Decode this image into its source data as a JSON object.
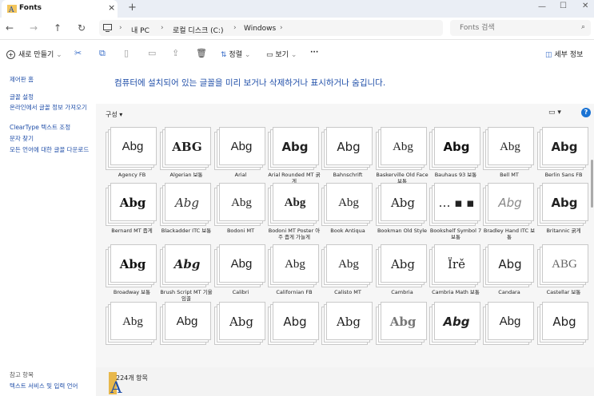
{
  "window": {
    "tab_title": "Fonts",
    "tab_close": "×",
    "new_tab": "+",
    "minimize": "—",
    "maximize": "☐",
    "close": "✕"
  },
  "nav": {
    "back": "←",
    "forward": "→",
    "up": "↑",
    "refresh": "↻"
  },
  "breadcrumb": [
    "내 PC",
    "로컬 디스크 (C:)",
    "Windows"
  ],
  "search": {
    "placeholder": "Fonts 검색"
  },
  "commands": {
    "new": "새로 만들기",
    "sort": "정렬",
    "view": "보기",
    "more": "···",
    "details": "세부 정보"
  },
  "sidebar": {
    "items": [
      "제어판 홈",
      "글꼴 설정",
      "온라인에서 글꼴 정보 가져오기",
      "ClearType 텍스트 조정",
      "문자 찾기",
      "모든 언어에 대한 글꼴 다운로드"
    ],
    "see_also_title": "참고 항목",
    "see_also": [
      "텍스트 서비스 및 입력 언어"
    ]
  },
  "main": {
    "headline": "컴퓨터에 설치되어 있는 글꼴을 미리 보거나 삭제하거나 표시하거나 숨깁니다.",
    "organize": "구성 ▾",
    "help": "?"
  },
  "fonts": [
    {
      "name": "Agency FB",
      "sample": "Abg",
      "family": "Liberation Sans Narrow",
      "weight": "normal",
      "style": "normal",
      "color": "#222222"
    },
    {
      "name": "Algerian 보통",
      "sample": "ABG",
      "family": "DejaVu Serif",
      "weight": "bold",
      "style": "normal",
      "color": "#222222"
    },
    {
      "name": "Arial",
      "sample": "Abg",
      "family": "Liberation Sans",
      "weight": "normal",
      "style": "normal",
      "color": "#222222"
    },
    {
      "name": "Arial Rounded MT 굵게",
      "sample": "Abg",
      "family": "DejaVu Sans",
      "weight": "bold",
      "style": "normal",
      "color": "#222222"
    },
    {
      "name": "Bahnschrift",
      "sample": "Abg",
      "family": "DejaVu Sans",
      "weight": "normal",
      "style": "normal",
      "color": "#222222"
    },
    {
      "name": "Baskerville Old Face 보통",
      "sample": "Abg",
      "family": "Liberation Serif",
      "weight": "normal",
      "style": "normal",
      "color": "#222222"
    },
    {
      "name": "Bauhaus 93 보통",
      "sample": "Abg",
      "family": "DejaVu Sans",
      "weight": "bold",
      "style": "normal",
      "color": "#111111"
    },
    {
      "name": "Bell MT",
      "sample": "Abg",
      "family": "Liberation Serif",
      "weight": "normal",
      "style": "normal",
      "color": "#222222"
    },
    {
      "name": "Berlin Sans FB",
      "sample": "Abg",
      "family": "DejaVu Sans",
      "weight": "bold",
      "style": "normal",
      "color": "#222222"
    },
    {
      "name": "Bernard MT 좁게",
      "sample": "Abg",
      "family": "DejaVu Serif",
      "weight": "bold",
      "style": "normal",
      "color": "#111111"
    },
    {
      "name": "Blackadder ITC 보통",
      "sample": "Abg",
      "family": "DejaVu Serif",
      "weight": "normal",
      "style": "italic",
      "color": "#333333"
    },
    {
      "name": "Bodoni MT",
      "sample": "Abg",
      "family": "Liberation Serif",
      "weight": "normal",
      "style": "normal",
      "color": "#222222"
    },
    {
      "name": "Bodoni MT Poster 아주 좁게 가늘게",
      "sample": "Abg",
      "family": "Liberation Serif",
      "weight": "bold",
      "style": "normal",
      "color": "#222222"
    },
    {
      "name": "Book Antiqua",
      "sample": "Abg",
      "family": "Liberation Serif",
      "weight": "normal",
      "style": "normal",
      "color": "#222222"
    },
    {
      "name": "Bookman Old Style",
      "sample": "Abg",
      "family": "DejaVu Serif",
      "weight": "normal",
      "style": "normal",
      "color": "#222222"
    },
    {
      "name": "Bookshelf Symbol 7 보통",
      "sample": ".‥ ▪ ▪",
      "family": "DejaVu Sans",
      "weight": "normal",
      "style": "normal",
      "color": "#222222"
    },
    {
      "name": "Bradley Hand ITC 보통",
      "sample": "Abg",
      "family": "DejaVu Sans",
      "weight": "normal",
      "style": "italic",
      "color": "#888888"
    },
    {
      "name": "Britannic 굵게",
      "sample": "Abg",
      "family": "DejaVu Sans",
      "weight": "bold",
      "style": "normal",
      "color": "#222222"
    },
    {
      "name": "Broadway 보통",
      "sample": "Abg",
      "family": "DejaVu Serif",
      "weight": "bold",
      "style": "normal",
      "color": "#111111"
    },
    {
      "name": "Brush Script MT 기울임꼴",
      "sample": "Abg",
      "family": "DejaVu Serif",
      "weight": "bold",
      "style": "italic",
      "color": "#222222"
    },
    {
      "name": "Calibri",
      "sample": "Abg",
      "family": "Liberation Sans",
      "weight": "normal",
      "style": "normal",
      "color": "#222222"
    },
    {
      "name": "Californian FB",
      "sample": "Abg",
      "family": "Liberation Serif",
      "weight": "normal",
      "style": "normal",
      "color": "#222222"
    },
    {
      "name": "Calisto MT",
      "sample": "Abg",
      "family": "Liberation Serif",
      "weight": "normal",
      "style": "normal",
      "color": "#222222"
    },
    {
      "name": "Cambria",
      "sample": "Abg",
      "family": "DejaVu Serif",
      "weight": "normal",
      "style": "normal",
      "color": "#222222"
    },
    {
      "name": "Cambria Math 보통",
      "sample": "Ïrě",
      "family": "DejaVu Serif",
      "weight": "normal",
      "style": "normal",
      "color": "#222222"
    },
    {
      "name": "Candara",
      "sample": "Abg",
      "family": "DejaVu Sans",
      "weight": "normal",
      "style": "normal",
      "color": "#222222"
    },
    {
      "name": "Castellar 보통",
      "sample": "ABG",
      "family": "Liberation Serif",
      "weight": "normal",
      "style": "normal",
      "color": "#666666"
    },
    {
      "name": "",
      "sample": "Abg",
      "family": "Liberation Serif",
      "weight": "normal",
      "style": "normal",
      "color": "#222222"
    },
    {
      "name": "",
      "sample": "Abg",
      "family": "Liberation Sans",
      "weight": "normal",
      "style": "normal",
      "color": "#222222"
    },
    {
      "name": "",
      "sample": "Abg",
      "family": "DejaVu Serif",
      "weight": "normal",
      "style": "normal",
      "color": "#222222"
    },
    {
      "name": "",
      "sample": "Abg",
      "family": "DejaVu Sans",
      "weight": "normal",
      "style": "normal",
      "color": "#222222"
    },
    {
      "name": "",
      "sample": "Abg",
      "family": "DejaVu Serif",
      "weight": "normal",
      "style": "normal",
      "color": "#222222"
    },
    {
      "name": "",
      "sample": "Abg",
      "family": "DejaVu Serif",
      "weight": "bold",
      "style": "normal",
      "color": "#777777"
    },
    {
      "name": "",
      "sample": "Abg",
      "family": "DejaVu Sans",
      "weight": "bold",
      "style": "italic",
      "color": "#222222"
    },
    {
      "name": "",
      "sample": "Abg",
      "family": "Liberation Sans",
      "weight": "normal",
      "style": "normal",
      "color": "#222222"
    },
    {
      "name": "",
      "sample": "Abg",
      "family": "DejaVu Sans",
      "weight": "normal",
      "style": "normal",
      "color": "#222222"
    }
  ],
  "status": {
    "count": "224개 항목"
  }
}
